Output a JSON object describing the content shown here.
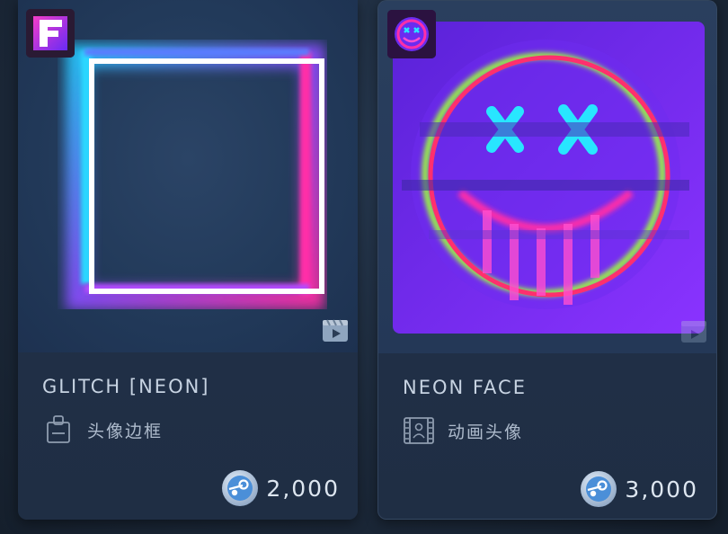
{
  "items": [
    {
      "name": "GLITCH [NEON]",
      "type": "头像边框",
      "type_icon": "avatar-frame-icon",
      "badge_letter": "F",
      "price": "2,000",
      "currency_icon": "steam-points-coin-icon"
    },
    {
      "name": "NEON FACE",
      "type": "动画头像",
      "type_icon": "animated-avatar-film-icon",
      "price": "3,000",
      "currency_icon": "steam-points-coin-icon"
    }
  ],
  "colors": {
    "background": "#1b2838",
    "card": "#22324a",
    "neon_pink": "#ff2fa8",
    "neon_cyan": "#28d8ff",
    "neon_green": "#9cff3a",
    "face_purple": "#7b2cff"
  }
}
